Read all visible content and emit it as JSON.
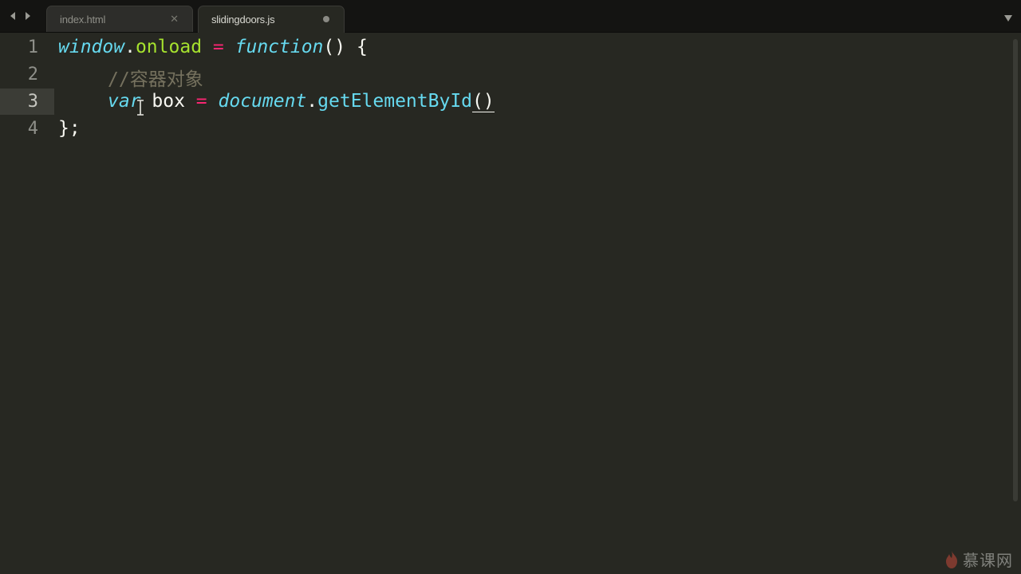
{
  "tabs": [
    {
      "label": "index.html",
      "state": "inactive",
      "indicator": "close-icon"
    },
    {
      "label": "slidingdoors.js",
      "state": "active",
      "indicator": "unsaved-dot"
    }
  ],
  "editor": {
    "lines": [
      {
        "number": "1",
        "tokens": {
          "window": "window",
          "dot1": ".",
          "onload": "onload",
          "sp1": " ",
          "eq": "=",
          "sp2": " ",
          "function": "function",
          "parens": "()",
          "brace": " {"
        }
      },
      {
        "number": "2",
        "tokens": {
          "comment_slashes": "//",
          "comment_text": "容器对象"
        }
      },
      {
        "number": "3",
        "current": true,
        "tokens": {
          "var": "var",
          "box": " box ",
          "eq": "=",
          "sp": " ",
          "document": "document",
          "dot": ".",
          "method": "getElementById",
          "parens": "()"
        }
      },
      {
        "number": "4",
        "tokens": {
          "close": "};"
        }
      }
    ]
  },
  "watermark": {
    "text": "慕课网"
  },
  "colors": {
    "background": "#272822",
    "keyword_pink": "#f92672",
    "storage_blue": "#66d9ef",
    "function_green": "#a6e22e",
    "comment": "#75715e",
    "foreground": "#f8f8f2"
  }
}
